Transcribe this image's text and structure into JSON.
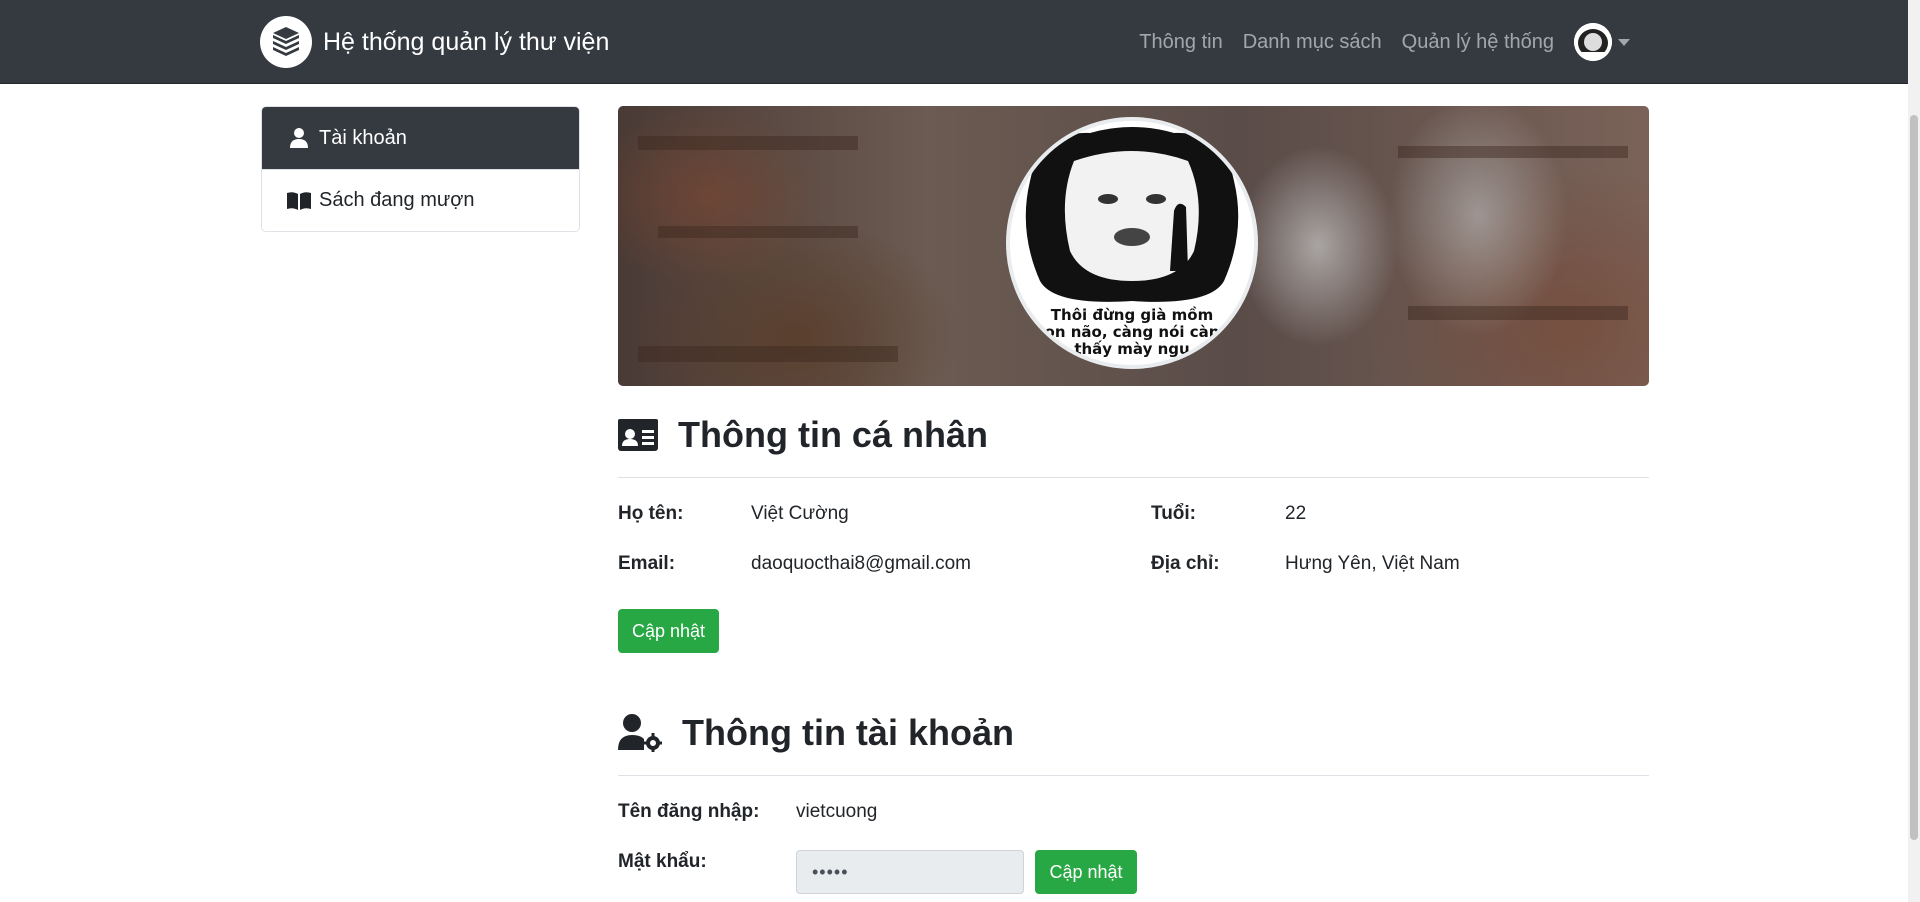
{
  "navbar": {
    "brand_title": "Hệ thống quản lý thư viện",
    "links": [
      "Thông tin",
      "Danh mục sách",
      "Quản lý hệ thống"
    ]
  },
  "sidebar": {
    "items": [
      {
        "label": "Tài khoản",
        "icon": "user-icon",
        "active": true
      },
      {
        "label": "Sách đang mượn",
        "icon": "book-open-icon",
        "active": false
      }
    ]
  },
  "profile": {
    "image_caption": [
      "Thôi đừng già mồm",
      "on não, càng nói càn",
      "thấy mày ngu"
    ]
  },
  "personal_info": {
    "title": "Thông tin cá nhân",
    "fields": {
      "name_label": "Họ tên:",
      "name_value": "Việt Cường",
      "age_label": "Tuổi:",
      "age_value": "22",
      "email_label": "Email:",
      "email_value": "daoquocthai8@gmail.com",
      "address_label": "Địa chỉ:",
      "address_value": "Hưng Yên, Việt Nam"
    },
    "update_label": "Cập nhật"
  },
  "account_info": {
    "title": "Thông tin tài khoản",
    "username_label": "Tên đăng nhập:",
    "username_value": "vietcuong",
    "password_label": "Mật khẩu:",
    "password_value": "•••••",
    "update_label": "Cập nhật"
  },
  "colors": {
    "navbar_bg": "#343a40",
    "success": "#28a745",
    "text": "#212529"
  }
}
